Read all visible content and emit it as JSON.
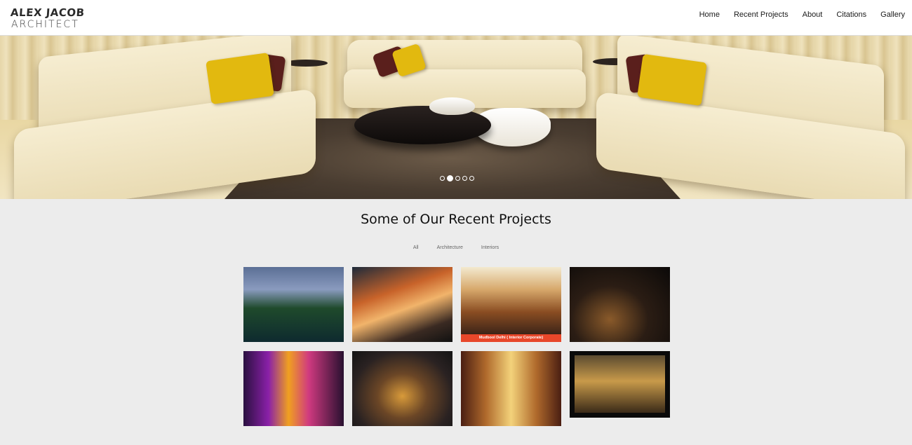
{
  "header": {
    "logo_line1": "ALEX JACOB",
    "logo_line2": "ARCHITECT",
    "nav": [
      "Home",
      "Recent Projects",
      "About",
      "Citations",
      "Gallery"
    ]
  },
  "hero": {
    "slides_total": 5,
    "active_slide": 2
  },
  "projects": {
    "title": "Some of Our Recent Projects",
    "filters": [
      "All",
      "Architecture",
      "Interiors"
    ],
    "tiles": [
      {
        "caption": ""
      },
      {
        "caption": ""
      },
      {
        "caption": "Mudbool Delhi ( Interior Corporate)"
      },
      {
        "caption": ""
      },
      {
        "caption": ""
      },
      {
        "caption": ""
      },
      {
        "caption": ""
      },
      {
        "caption": ""
      }
    ]
  }
}
